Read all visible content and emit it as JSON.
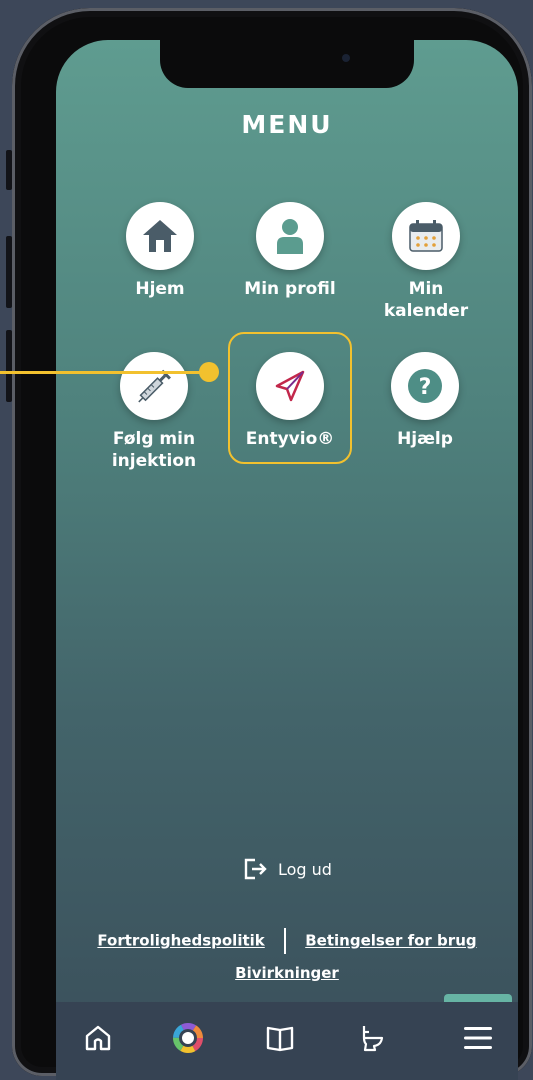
{
  "menu": {
    "title": "MENU",
    "items": [
      {
        "label": "Hjem",
        "icon": "home-icon"
      },
      {
        "label": "Min profil",
        "icon": "person-icon"
      },
      {
        "label": "Min kalender",
        "icon": "calendar-icon"
      },
      {
        "label": "Følg min injektion",
        "icon": "syringe-icon"
      },
      {
        "label": "Entyvio®",
        "icon": "entyvio-logo-icon"
      },
      {
        "label": "Hjælp",
        "icon": "question-icon"
      }
    ]
  },
  "logout": {
    "label": "Log ud"
  },
  "links": {
    "privacy": "Fortrolighedspolitik",
    "terms": "Betingelser for brug",
    "side_effects": "Bivirkninger"
  },
  "tabbar": {
    "tabs": [
      {
        "icon": "home-outline-icon"
      },
      {
        "icon": "color-wheel-icon"
      },
      {
        "icon": "book-icon"
      },
      {
        "icon": "toilet-icon"
      },
      {
        "icon": "hamburger-menu-icon",
        "active": true
      }
    ]
  },
  "colors": {
    "highlight": "#f2c12e",
    "accent": "#67b4a4",
    "header_teal": "#5f9c90"
  }
}
